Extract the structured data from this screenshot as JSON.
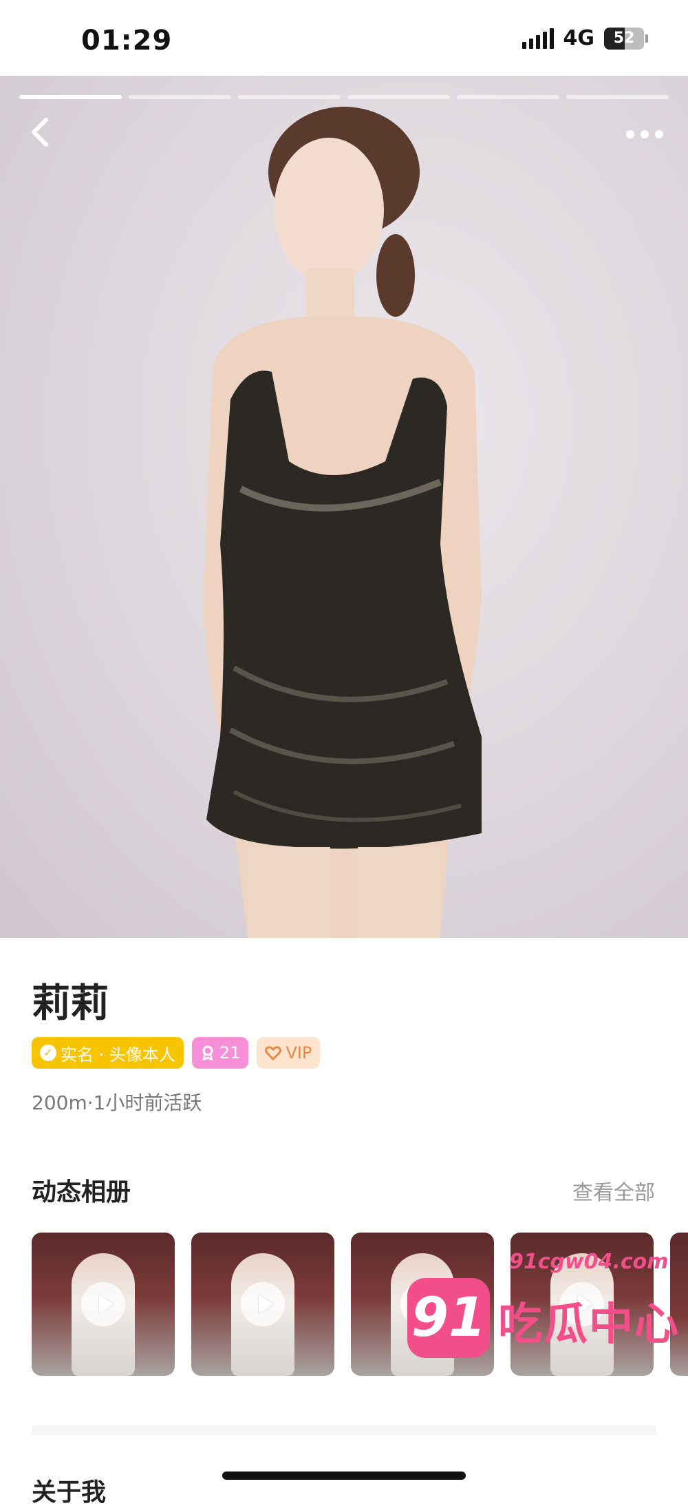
{
  "status_bar": {
    "time": "01:29",
    "network": "4G",
    "battery": "52",
    "battery_level": 0.52
  },
  "header": {
    "photo_count": 6,
    "active_photo": 1,
    "back_icon": "chevron-left-icon",
    "more_icon": "more-dots-icon"
  },
  "profile": {
    "name": "莉莉",
    "badges": {
      "verified": "实名 · 头像本人",
      "level": "21",
      "vip": "VIP"
    },
    "meta": "200m·1小时前活跃"
  },
  "album": {
    "title": "动态相册",
    "see_all": "查看全部",
    "items": [
      {
        "type": "video"
      },
      {
        "type": "video"
      },
      {
        "type": "video"
      },
      {
        "type": "video"
      }
    ]
  },
  "about": {
    "title": "关于我"
  },
  "watermark": {
    "url": "91cgw04.com",
    "logo": "91",
    "text": "吃瓜中心"
  },
  "colors": {
    "verified": "#f6c400",
    "level": "#f78fd8",
    "vip": "#e58a44",
    "watermark": "#f24f8a"
  }
}
